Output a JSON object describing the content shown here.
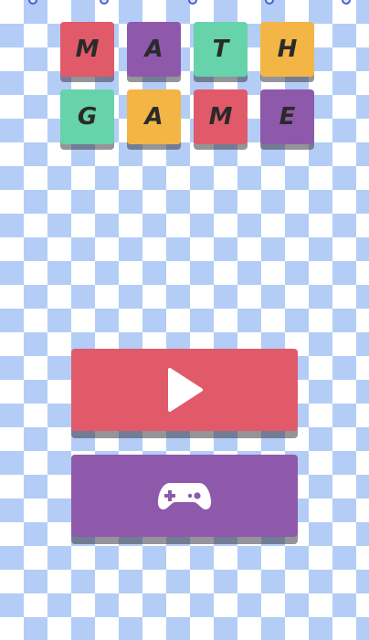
{
  "title_tiles": [
    {
      "letter": "M",
      "color": "#e05a6a"
    },
    {
      "letter": "A",
      "color": "#8e59ab"
    },
    {
      "letter": "T",
      "color": "#66d3aa"
    },
    {
      "letter": "H",
      "color": "#f3b545"
    },
    {
      "letter": "G",
      "color": "#66d3aa"
    },
    {
      "letter": "A",
      "color": "#f3b545"
    },
    {
      "letter": "M",
      "color": "#e05a6a"
    },
    {
      "letter": "E",
      "color": "#8e59ab"
    }
  ],
  "buttons": {
    "play": {
      "icon": "play-icon",
      "color": "#e05a6a"
    },
    "games": {
      "icon": "gamepad-icon",
      "color": "#8e59ab"
    }
  },
  "background": {
    "pattern": "diamond-checker",
    "color_a": "#b3cdf6",
    "color_b": "#ffffff"
  }
}
